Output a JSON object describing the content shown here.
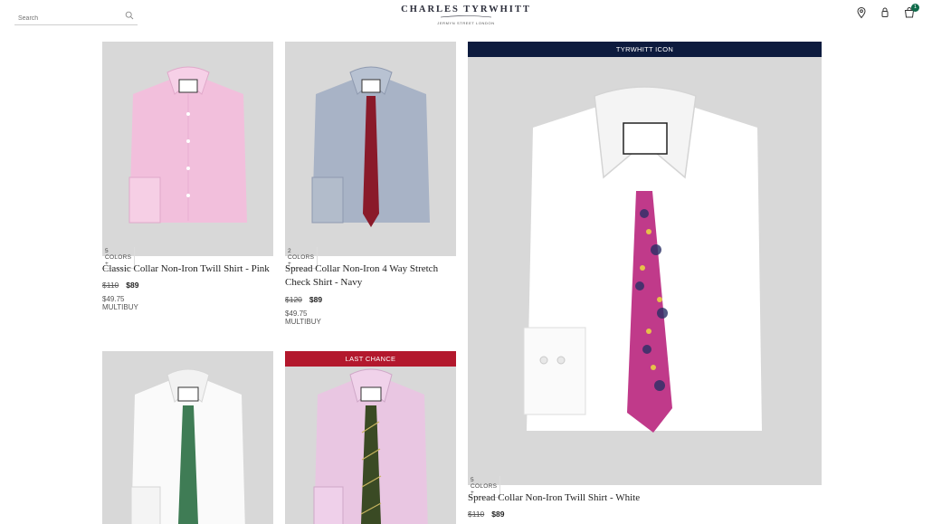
{
  "header": {
    "search_placeholder": "Search",
    "brand": "CHARLES TYRWHITT",
    "brand_tagline": "JERMYN STREET LONDON",
    "bag_count": "1",
    "icons": [
      "search-icon",
      "location-pin-icon",
      "account-icon",
      "bag-icon"
    ]
  },
  "products": [
    {
      "colors": "5 COLORS +",
      "title": "Classic Collar Non-Iron Twill Shirt - Pink",
      "price_was": "$110",
      "price_now": "$89",
      "multibuy": "$49.75 MULTIBUY",
      "shirt_color": "#f2bfdc",
      "tie_color": ""
    },
    {
      "colors": "2 COLORS +",
      "title_line1": "Spread Collar Non-Iron 4 Way Stretch",
      "title_line2": "Check Shirt - Navy",
      "price_was": "$120",
      "price_now": "$89",
      "multibuy": "$49.75 MULTIBUY",
      "shirt_color": "#a8b3c6",
      "tie_color": "#8a1a2a"
    },
    {
      "banner": "TYRWHITT ICON",
      "colors": "5 COLORS +",
      "title": "Spread Collar Non-Iron Twill Shirt - White",
      "price_was": "$110",
      "price_now": "$89",
      "shirt_color": "#ffffff",
      "tie_color": "#c03a8a"
    },
    {
      "shirt_color": "#fafafa",
      "tie_color": "#3f7c55"
    },
    {
      "banner": "LAST CHANCE",
      "shirt_color": "#e9c6e2",
      "tie_color": "#3a4a24"
    }
  ]
}
